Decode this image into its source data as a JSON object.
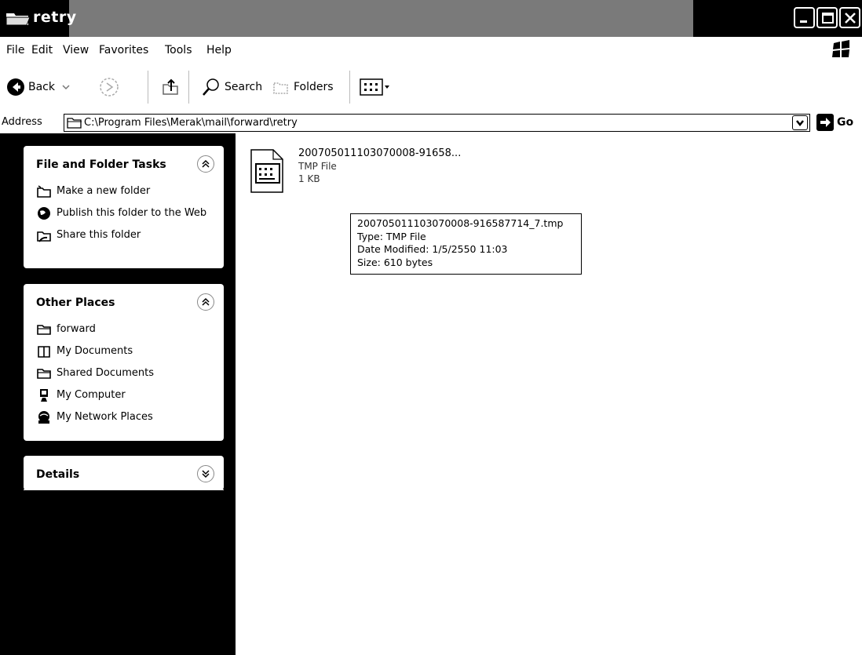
{
  "window": {
    "title": "retry",
    "buttons": {
      "minimize": "minimize",
      "maximize": "maximize",
      "close": "close"
    }
  },
  "menu": {
    "items": [
      "File",
      "Edit",
      "View",
      "Favorites",
      "Tools",
      "Help"
    ]
  },
  "toolbar": {
    "back_label": "Back",
    "search_label": "Search",
    "folders_label": "Folders"
  },
  "address": {
    "label": "Address",
    "value": "C:\\Program Files\\Merak\\mail\\forward\\retry",
    "go_label": "Go"
  },
  "tasks_panel": {
    "title": "File and Folder Tasks",
    "items": [
      {
        "label": "Make a new folder",
        "icon": "new-folder-icon"
      },
      {
        "label": "Publish this folder to the Web",
        "icon": "globe-icon"
      },
      {
        "label": "Share this folder",
        "icon": "share-folder-icon"
      }
    ]
  },
  "places_panel": {
    "title": "Other Places",
    "items": [
      {
        "label": "forward",
        "icon": "folder-icon"
      },
      {
        "label": "My Documents",
        "icon": "my-documents-icon"
      },
      {
        "label": "Shared Documents",
        "icon": "shared-folder-icon"
      },
      {
        "label": "My Computer",
        "icon": "computer-icon"
      },
      {
        "label": "My Network Places",
        "icon": "network-icon"
      }
    ]
  },
  "details_panel": {
    "title": "Details"
  },
  "file": {
    "name": "20070501110307000​8-91658...",
    "type": "TMP File",
    "size": "1 KB"
  },
  "tooltip": {
    "name": "20070501110307000​8-916587714_7.tmp",
    "type": "Type: TMP File",
    "modified": "Date Modified: 1/5/2550 11:03",
    "size": "Size: 610 bytes"
  },
  "colors": {
    "titlebar": "#000000",
    "titlebar_fill": "#7a7a7a",
    "left_pane": "#000000",
    "panel": "#ffffff"
  }
}
